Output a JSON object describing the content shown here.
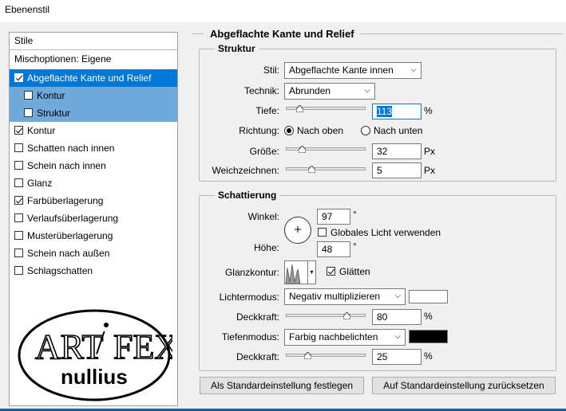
{
  "window": {
    "title": "Ebenenstil"
  },
  "left": {
    "header": "Stile",
    "items": [
      {
        "label": "Mischoptionen: Eigene",
        "checkbox": false,
        "checked": false,
        "state": "normal"
      },
      {
        "label": "Abgeflachte Kante und Relief",
        "checkbox": true,
        "checked": true,
        "state": "selected"
      },
      {
        "label": "Kontur",
        "checkbox": true,
        "checked": false,
        "state": "sub"
      },
      {
        "label": "Struktur",
        "checkbox": true,
        "checked": false,
        "state": "sub"
      },
      {
        "label": "Kontur",
        "checkbox": true,
        "checked": true,
        "state": "normal"
      },
      {
        "label": "Schatten nach innen",
        "checkbox": true,
        "checked": false,
        "state": "normal"
      },
      {
        "label": "Schein nach innen",
        "checkbox": true,
        "checked": false,
        "state": "normal"
      },
      {
        "label": "Glanz",
        "checkbox": true,
        "checked": false,
        "state": "normal"
      },
      {
        "label": "Farbüberlagerung",
        "checkbox": true,
        "checked": true,
        "state": "normal"
      },
      {
        "label": "Verlaufsüberlagerung",
        "checkbox": true,
        "checked": false,
        "state": "normal"
      },
      {
        "label": "Musterüberlagerung",
        "checkbox": true,
        "checked": false,
        "state": "normal"
      },
      {
        "label": "Schein nach außen",
        "checkbox": true,
        "checked": false,
        "state": "normal"
      },
      {
        "label": "Schlagschatten",
        "checkbox": true,
        "checked": false,
        "state": "normal"
      }
    ],
    "logo": {
      "top_text": "ART",
      "mid_text": "FEX",
      "bottom_text": "nullius"
    }
  },
  "bevel": {
    "title": "Abgeflachte Kante und Relief",
    "structure": {
      "title": "Struktur",
      "stil_label": "Stil:",
      "stil_value": "Abgeflachte Kante innen",
      "technik_label": "Technik:",
      "technik_value": "Abrunden",
      "tiefe_label": "Tiefe:",
      "tiefe_value": "113",
      "tiefe_unit": "%",
      "tiefe_level": 0.13,
      "richtung_label": "Richtung:",
      "richtung_up": "Nach oben",
      "richtung_down": "Nach unten",
      "richtung_selected": "up",
      "groesse_label": "Größe:",
      "groesse_value": "32",
      "groesse_unit": "Px",
      "groesse_level": 0.17,
      "weich_label": "Weichzeichnen:",
      "weich_value": "5",
      "weich_unit": "Px",
      "weich_level": 0.3
    },
    "shading": {
      "title": "Schattierung",
      "winkel_label": "Winkel:",
      "winkel_value": "97",
      "winkel_unit": "°",
      "global_light_label": "Globales Licht verwenden",
      "global_light_checked": false,
      "hoehe_label": "Höhe:",
      "hoehe_value": "48",
      "hoehe_unit": "°",
      "glanz_label": "Glanzkontur:",
      "glaetten_label": "Glätten",
      "glaetten_checked": true,
      "licht_label": "Lichtermodus:",
      "licht_value": "Negativ multiplizieren",
      "licht_color": "#ffffff",
      "deck1_label": "Deckkraft:",
      "deck1_value": "80",
      "deck1_unit": "%",
      "deck1_level": 0.8,
      "tiefen_label": "Tiefenmodus:",
      "tiefen_value": "Farbig nachbelichten",
      "tiefen_color": "#000000",
      "deck2_label": "Deckkraft:",
      "deck2_value": "25",
      "deck2_unit": "%",
      "deck2_level": 0.25
    },
    "buttons": {
      "set_default": "Als Standardeinstellung festlegen",
      "reset_default": "Auf Standardeinstellung zurücksetzen"
    }
  }
}
